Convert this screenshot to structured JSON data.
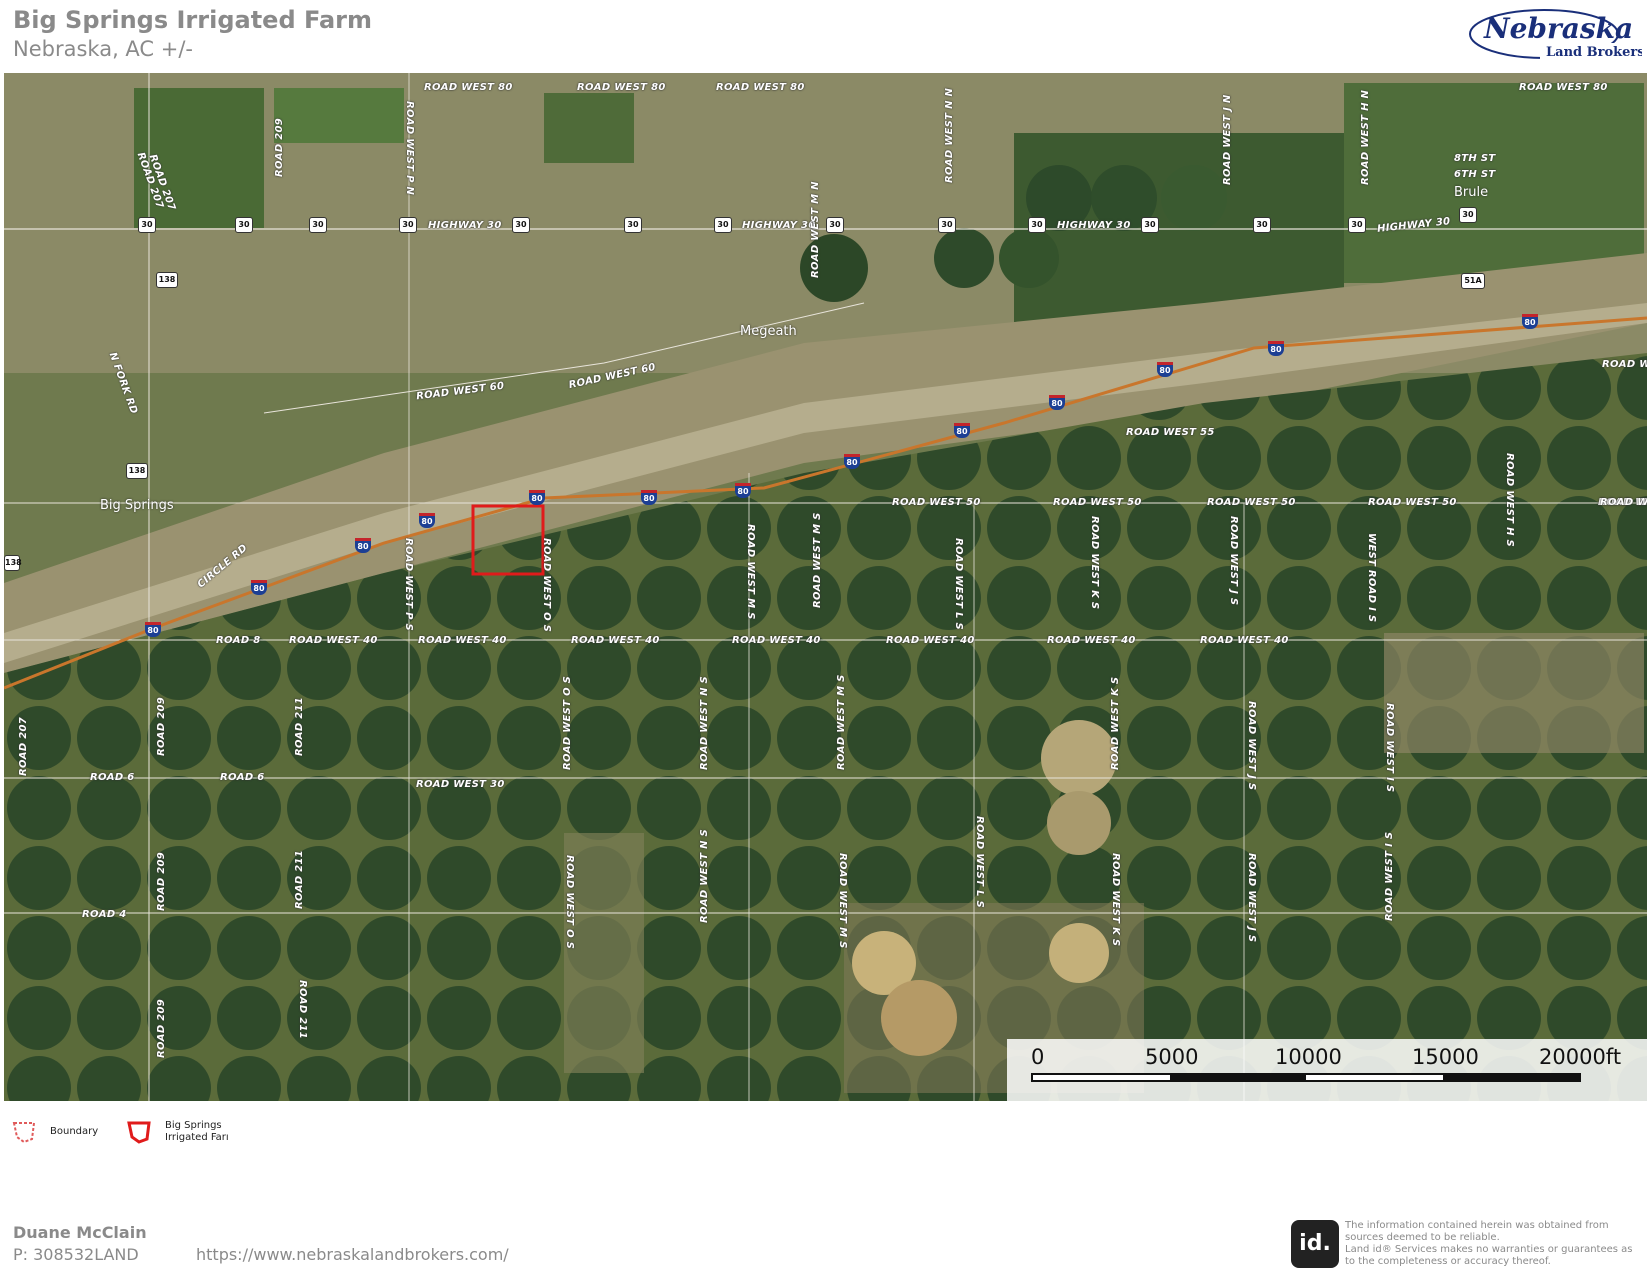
{
  "header": {
    "title": "Big Springs Irrigated Farm",
    "subtitle": "Nebraska,  AC +/-"
  },
  "logo": {
    "text_main": "Nebraska",
    "text_sub": "Land Brokers"
  },
  "map": {
    "road_labels": [
      "ROAD WEST 80",
      "ROAD WEST 80",
      "ROAD WEST 80",
      "ROAD WEST 80",
      "HIGHWAY 30",
      "HIGHWAY 30",
      "HIGHWAY 30",
      "HIGHWAY 30",
      "ROAD WEST 60",
      "ROAD WEST 60",
      "ROAD WEST 55",
      "ROAD WEST 50",
      "ROAD WEST 50",
      "ROAD WEST 50",
      "ROAD WEST 50",
      "ROAD WEST 50",
      "ROAD WEST 40",
      "ROAD WEST 40",
      "ROAD WEST 40",
      "ROAD WEST 40",
      "ROAD WEST 40",
      "ROAD WEST 40",
      "ROAD WEST 40",
      "ROAD WEST 30",
      "ROAD 8",
      "ROAD 6",
      "ROAD 6",
      "ROAD 4",
      "CIRCLE RD",
      "N FORK RD",
      "8TH ST",
      "6TH ST",
      "ROAD WES",
      "ROAD WE"
    ],
    "vertical_labels": [
      "ROAD 207",
      "ROAD 209",
      "ROAD WEST P N",
      "ROAD WEST N N",
      "ROAD WEST M N",
      "ROAD WEST J N",
      "ROAD WEST H N",
      "ROAD WEST P S",
      "ROAD WEST O S",
      "ROAD WEST M S",
      "ROAD WEST M S",
      "ROAD WEST L S",
      "ROAD WEST K S",
      "ROAD WEST J S",
      "WEST ROAD I S",
      "ROAD WEST H S",
      "ROAD 207",
      "ROAD 209",
      "ROAD 211",
      "ROAD WEST O S",
      "ROAD WEST N S",
      "ROAD WEST M S",
      "ROAD WEST K S",
      "ROAD WEST J S",
      "ROAD WEST I S",
      "ROAD 209",
      "ROAD 211",
      "ROAD WEST O S",
      "ROAD WEST N S",
      "ROAD WEST M S",
      "ROAD WEST L S",
      "ROAD WEST K S",
      "ROAD WEST J S",
      "ROAD WEST I S",
      "ROAD 209",
      "ROAD 211",
      "ROAD 207"
    ],
    "towns": [
      "Megeath",
      "Big Springs",
      "Brule"
    ],
    "us_shields": [
      "30",
      "30",
      "30",
      "30",
      "30",
      "30",
      "30",
      "30",
      "30",
      "30",
      "30",
      "30",
      "30",
      "30",
      "138",
      "138",
      "138"
    ],
    "interstate_shields": [
      "80",
      "80",
      "80",
      "80",
      "80",
      "80",
      "80",
      "80",
      "80",
      "80",
      "80",
      "80",
      "80"
    ],
    "state_shields": [
      "51A"
    ],
    "colors": {
      "boundary": "#e01b1b",
      "interstate": "#c9762c",
      "road": "#e8e4da"
    }
  },
  "scale_bar": {
    "labels": [
      "0",
      "5000",
      "10000",
      "15000",
      "20000ft"
    ]
  },
  "legend": {
    "items": [
      {
        "label_line1": "Boundary",
        "label_line2": ""
      },
      {
        "label_line1": "Big Springs",
        "label_line2": "Irrigated Farı"
      }
    ]
  },
  "footer": {
    "agent_name": "Duane McClain",
    "phone": "P: 308532LAND",
    "url": "https://www.nebraskalandbrokers.com/",
    "id_logo": "id.",
    "disclaimer": "The information contained herein was obtained from sources deemed to be reliable.\n Land id® Services makes no warranties or guarantees as to the completeness or accuracy thereof."
  }
}
